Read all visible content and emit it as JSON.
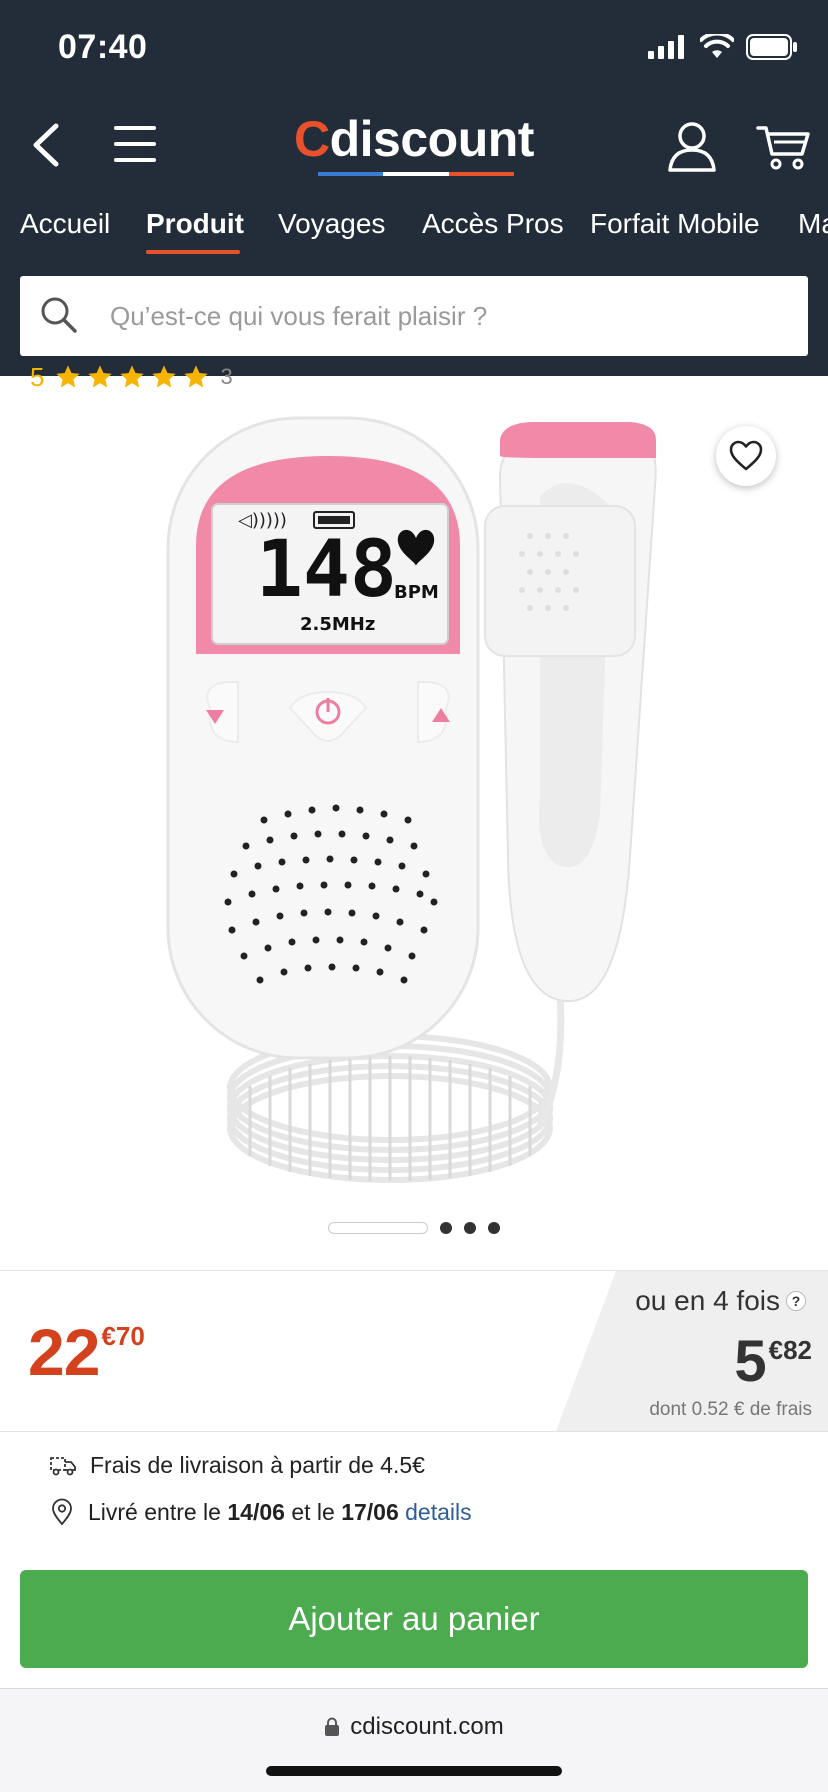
{
  "status_bar": {
    "time": "07:40"
  },
  "header": {
    "logo": {
      "c": "C",
      "rest": "discount"
    },
    "nav_tabs": [
      "Accueil",
      "Produit",
      "Voyages",
      "Accès Pros",
      "Forfait Mobile",
      "Ma"
    ],
    "active_tab": "Produit",
    "search": {
      "placeholder": "Qu’est-ce qui vous ferait plaisir ?"
    }
  },
  "rating": {
    "score": "5",
    "count": "3"
  },
  "product_display": {
    "reading": "148",
    "unit": "BPM",
    "frequency": "2.5MHz"
  },
  "carousel": {
    "total": 4,
    "active_index": 0
  },
  "price": {
    "integer": "22",
    "cents": "€70",
    "installment_label": "ou en 4 fois",
    "installment_integer": "5",
    "installment_cents": "€82",
    "installment_fees": "dont 0.52 € de frais"
  },
  "delivery": {
    "fee_text": "Frais de livraison à partir de 4.5€",
    "date_prefix": "Livré entre le",
    "date_from": "14/06",
    "date_mid": "et le",
    "date_to": "17/06",
    "details_link": "details"
  },
  "cta": {
    "add_to_cart": "Ajouter au panier"
  },
  "browser": {
    "url": "cdiscount.com"
  },
  "colors": {
    "header_bg": "#232d3a",
    "brand_orange": "#e9512d",
    "price_red": "#d3411f",
    "cta_green": "#4caa4f",
    "pink": "#f08aa8"
  }
}
